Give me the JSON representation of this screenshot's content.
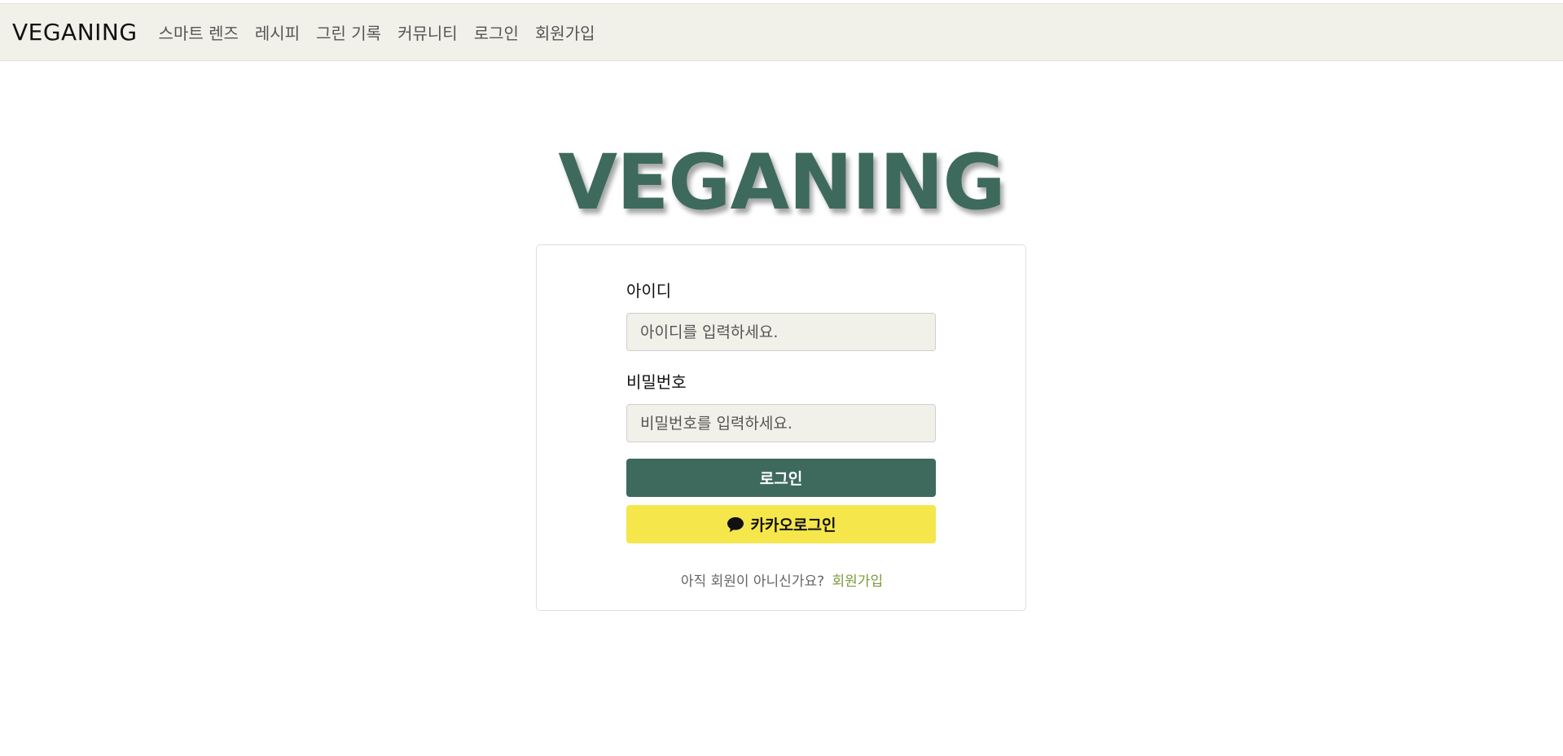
{
  "colors": {
    "primary": "#3d6a5c",
    "kakao": "#f5e64b",
    "accent_link": "#7a9b3a",
    "nav_bg": "#f1f0e9"
  },
  "navbar": {
    "brand": "VEGANING",
    "links": [
      "스마트 렌즈",
      "레시피",
      "그린 기록",
      "커뮤니티",
      "로그인",
      "회원가입"
    ]
  },
  "logo": {
    "text": "VEGANING"
  },
  "login_form": {
    "id_label": "아이디",
    "id_placeholder": "아이디를 입력하세요.",
    "password_label": "비밀번호",
    "password_placeholder": "비밀번호를 입력하세요.",
    "login_button": "로그인",
    "kakao_button": "카카오로그인",
    "kakao_icon": "chat-bubble-icon",
    "signup_prompt": "아직 회원이 아니신가요?",
    "signup_link": "회원가입"
  }
}
